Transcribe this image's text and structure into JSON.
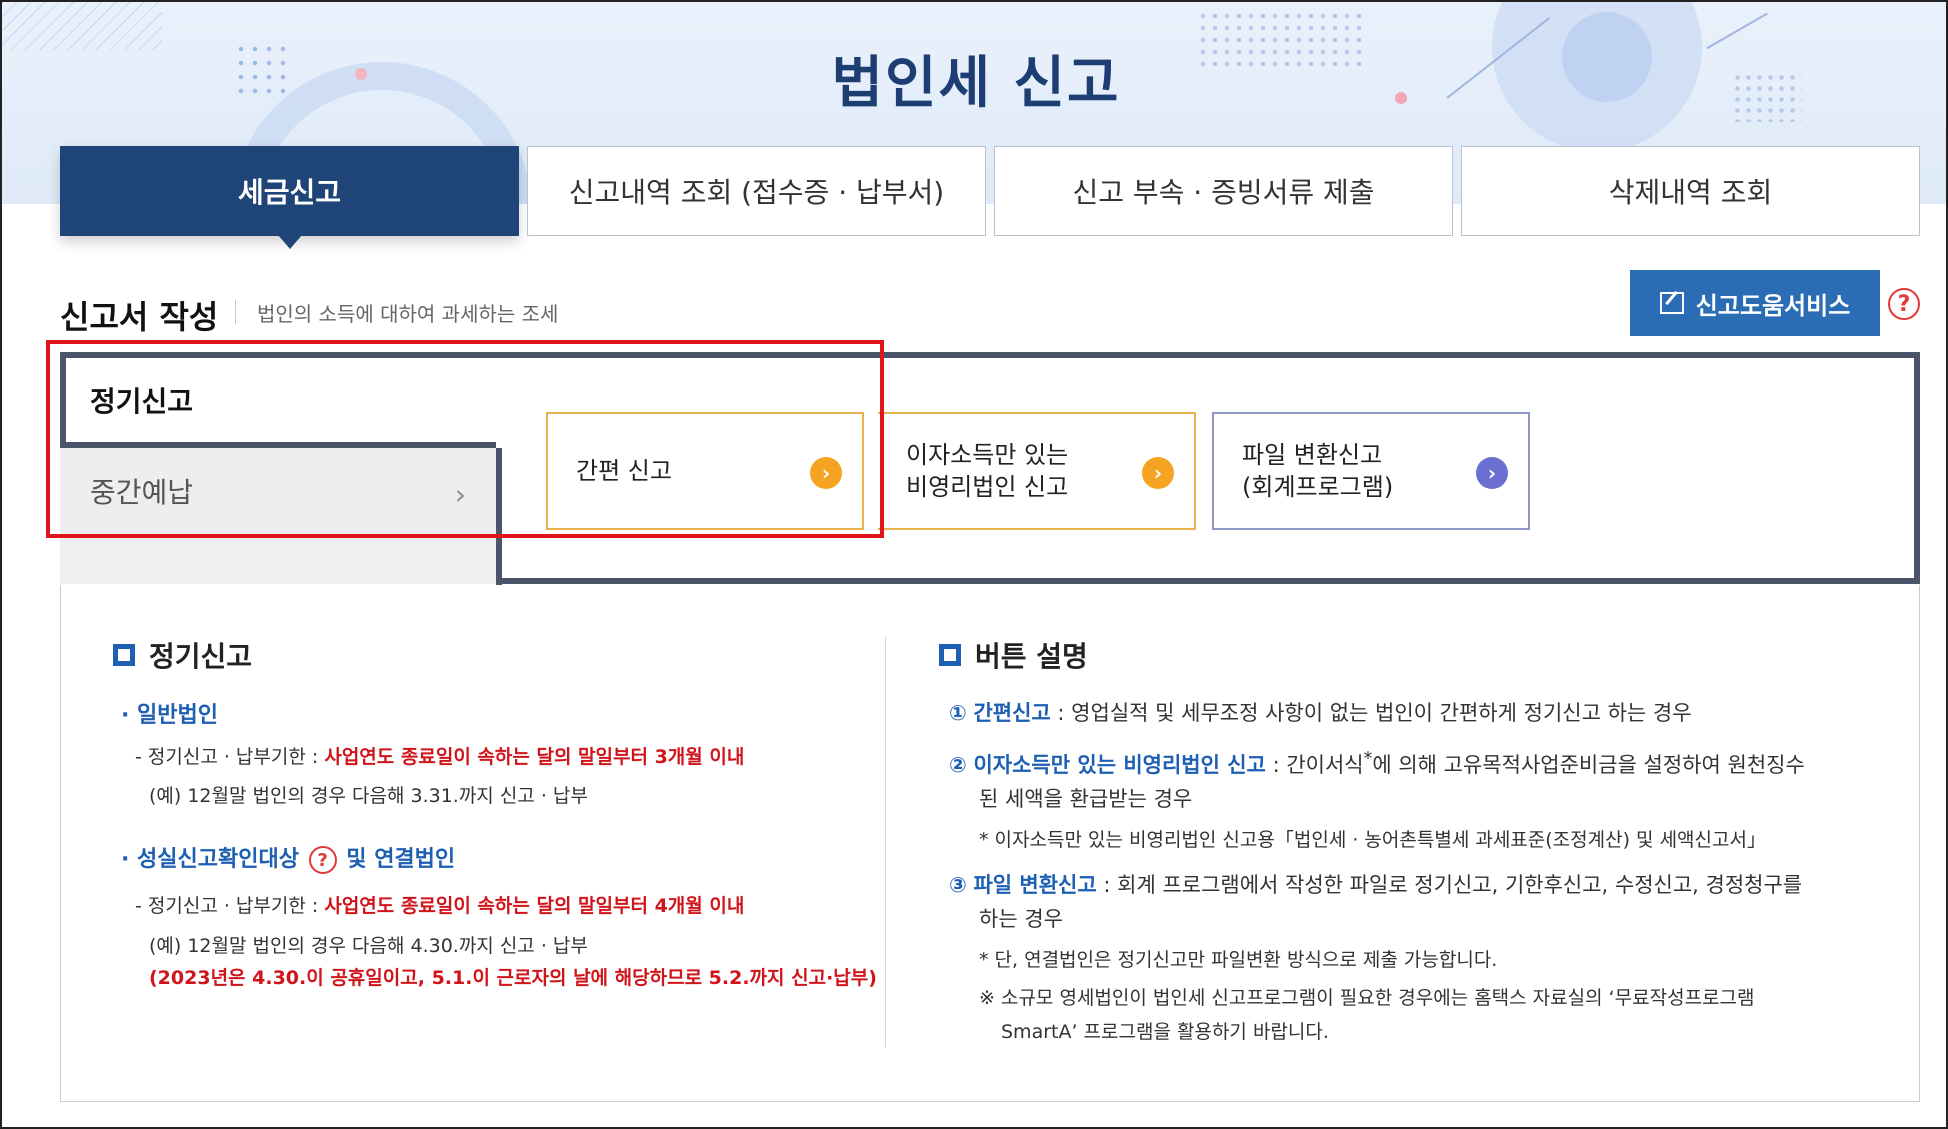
{
  "header": {
    "title": "법인세 신고"
  },
  "tabs": [
    {
      "label": "세금신고",
      "active": true
    },
    {
      "label": "신고내역 조회 (접수증 · 납부서)",
      "active": false
    },
    {
      "label": "신고 부속 · 증빙서류 제출",
      "active": false
    },
    {
      "label": "삭제내역 조회",
      "active": false
    }
  ],
  "section": {
    "title": "신고서 작성",
    "description": "법인의 소득에 대하여 과세하는 조세",
    "help_button": "신고도움서비스",
    "help_icon": "?"
  },
  "filing_menu": {
    "items": [
      {
        "label": "정기신고",
        "selected": true
      },
      {
        "label": "중간예납",
        "selected": false
      }
    ],
    "cards": [
      {
        "line1": "간편 신고",
        "line2": "",
        "arrow_icon": "chevron-right-icon",
        "arrow_color": "#f5a321"
      },
      {
        "line1": "이자소득만 있는",
        "line2": "비영리법인 신고",
        "arrow_icon": "chevron-right-icon",
        "arrow_color": "#f5a321"
      },
      {
        "line1": "파일 변환신고",
        "line2": "(회계프로그램)",
        "arrow_icon": "chevron-right-icon",
        "arrow_color": "#6b6fd1"
      }
    ]
  },
  "info_left": {
    "title": "정기신고",
    "general": {
      "heading": "일반법인",
      "deadline_prefix": "- 정기신고 · 납부기한 : ",
      "deadline_value": "사업연도 종료일이 속하는 달의 말일부터 3개월 이내",
      "example": "(예) 12월말 법인의 경우 다음해 3.31.까지 신고 · 납부"
    },
    "sincere": {
      "heading_a": "성실신고확인대상",
      "help_icon": "?",
      "heading_b": "및 연결법인",
      "deadline_prefix": "- 정기신고 · 납부기한 : ",
      "deadline_value": "사업연도 종료일이 속하는 달의 말일부터 4개월 이내",
      "example": "(예) 12월말 법인의 경우 다음해 4.30.까지 신고 · 납부",
      "note": "(2023년은 4.30.이 공휴일이고, 5.1.이 근로자의 날에 해당하므로 5.2.까지 신고·납부)"
    }
  },
  "info_right": {
    "title": "버튼 설명",
    "item1": {
      "num": "①",
      "label": "간편신고",
      "text": " : 영업실적 및 세무조정 사항이 없는 법인이 간편하게 정기신고 하는 경우"
    },
    "item2": {
      "num": "②",
      "label": "이자소득만 있는 비영리법인 신고",
      "text_a": " : 간이서식",
      "sup": "*",
      "text_b": "에 의해 고유목적사업준비금을 설정하여 원천징수",
      "text2": "된 세액을 환급받는 경우",
      "note": "* 이자소득만 있는 비영리법인 신고용「법인세 · 농어촌특별세 과세표준(조정계산) 및 세액신고서」"
    },
    "item3": {
      "num": "③",
      "label": "파일 변환신고",
      "text": " : 회계 프로그램에서 작성한 파일로 정기신고, 기한후신고, 수정신고, 경정청구를",
      "text2": "하는 경우",
      "note": "* 단, 연결법인은 정기신고만 파일변환 방식으로 제출 가능합니다.",
      "note2a": "※ 소규모 영세법인이 법인세 신고프로그램이 필요한 경우에는 홈택스 자료실의 ‘무료작성프로그램",
      "note2b": "SmartA’ 프로그램을 활용하기 바랍니다."
    }
  },
  "colors": {
    "brand_navy": "#1f4478",
    "accent_blue": "#2b6db4",
    "highlight_red": "#e0141a"
  }
}
